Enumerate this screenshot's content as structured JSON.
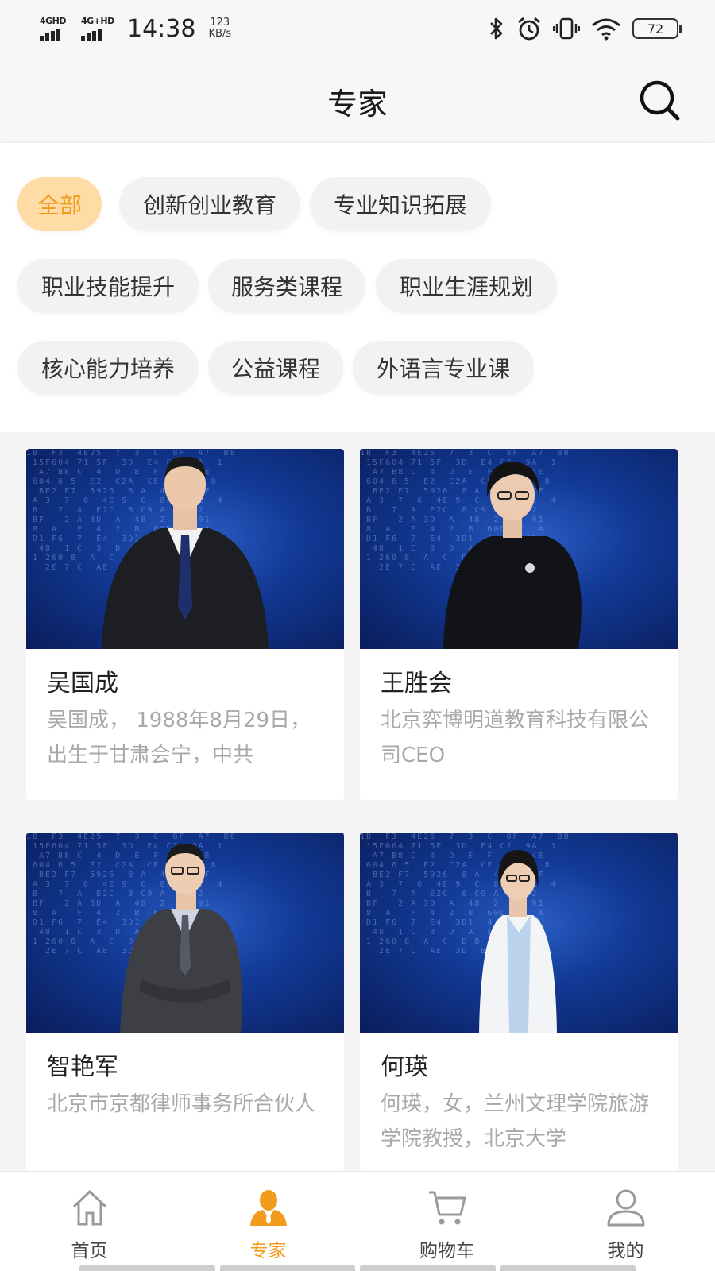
{
  "status_bar": {
    "net1": "4GHD",
    "net2": "4G+HD",
    "time": "14:38",
    "speed_value": "123",
    "speed_unit": "KB/s",
    "battery": "72",
    "icons": [
      "bluetooth-icon",
      "alarm-icon",
      "vibrate-icon",
      "wifi-icon",
      "battery-icon"
    ]
  },
  "header": {
    "title": "专家",
    "search_icon": "search-icon"
  },
  "filters": [
    {
      "label": "全部",
      "active": true
    },
    {
      "label": "创新创业教育",
      "active": false
    },
    {
      "label": "专业知识拓展",
      "active": false
    },
    {
      "label": "职业技能提升",
      "active": false
    },
    {
      "label": "服务类课程",
      "active": false
    },
    {
      "label": "职业生涯规划",
      "active": false
    },
    {
      "label": "核心能力培养",
      "active": false
    },
    {
      "label": "公益课程",
      "active": false
    },
    {
      "label": "外语言专业课",
      "active": false
    }
  ],
  "experts": [
    {
      "name": "吴国成",
      "desc": "吴国成， 1988年8月29日，出生于甘肃会宁，中共"
    },
    {
      "name": "王胜会",
      "desc": "北京弈博明道教育科技有限公司CEO"
    },
    {
      "name": "智艳军",
      "desc": "北京市京都律师事务所合伙人"
    },
    {
      "name": "何瑛",
      "desc": "何瑛，女，兰州文理学院旅游学院教授，北京大学"
    }
  ],
  "bottom_nav": [
    {
      "label": "首页",
      "icon": "home-icon",
      "active": false
    },
    {
      "label": "专家",
      "icon": "expert-icon",
      "active": true
    },
    {
      "label": "购物车",
      "icon": "cart-icon",
      "active": false
    },
    {
      "label": "我的",
      "icon": "profile-icon",
      "active": false
    }
  ],
  "colors": {
    "accent": "#f39b1c",
    "chip_active_bg": "#ffdca6",
    "chip_bg": "#f2f2f2",
    "desc_text": "#a9a9a9"
  }
}
